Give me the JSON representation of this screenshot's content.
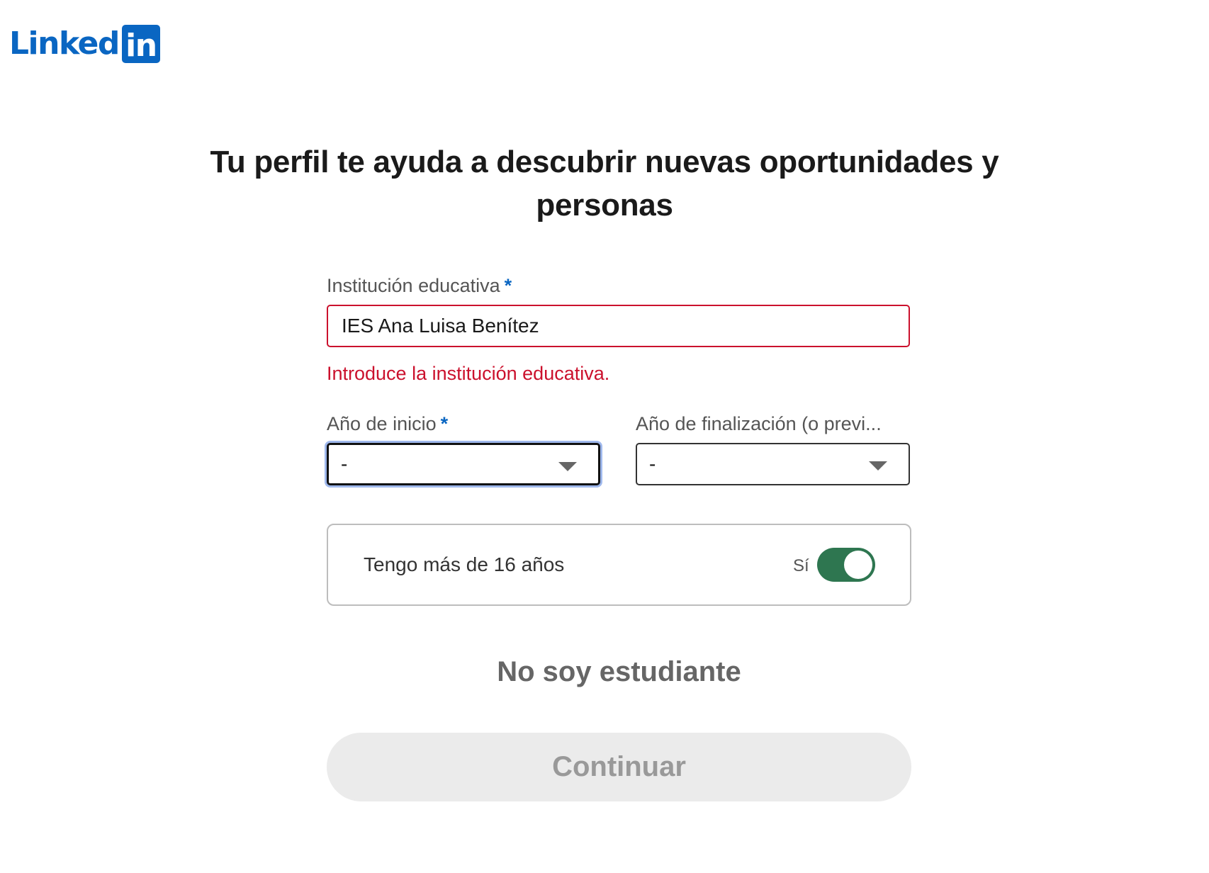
{
  "brand": {
    "logo_word": "Linked",
    "logo_box": "in",
    "color": "#0a66c2"
  },
  "headline": "Tu perfil te ayuda a descubrir nuevas oportunidades y personas",
  "form": {
    "institution": {
      "label": "Institución educativa",
      "required_mark": "*",
      "value": "IES Ana Luisa Benítez",
      "error": "Introduce la institución educativa."
    },
    "start_year": {
      "label": "Año de inicio",
      "required_mark": "*",
      "selected": "-"
    },
    "end_year": {
      "label": "Año de finalización (o previ...",
      "selected": "-"
    },
    "age_check": {
      "text": "Tengo más de 16 años",
      "toggle_label": "Sí",
      "toggle_on": true
    }
  },
  "actions": {
    "not_student": "No soy estudiante",
    "continue": "Continuar"
  },
  "colors": {
    "error": "#cb112d",
    "toggle_on": "#2e7650",
    "focus_ring": "#9fb8ec"
  },
  "icons": {
    "dropdown": "caret-down-icon"
  }
}
